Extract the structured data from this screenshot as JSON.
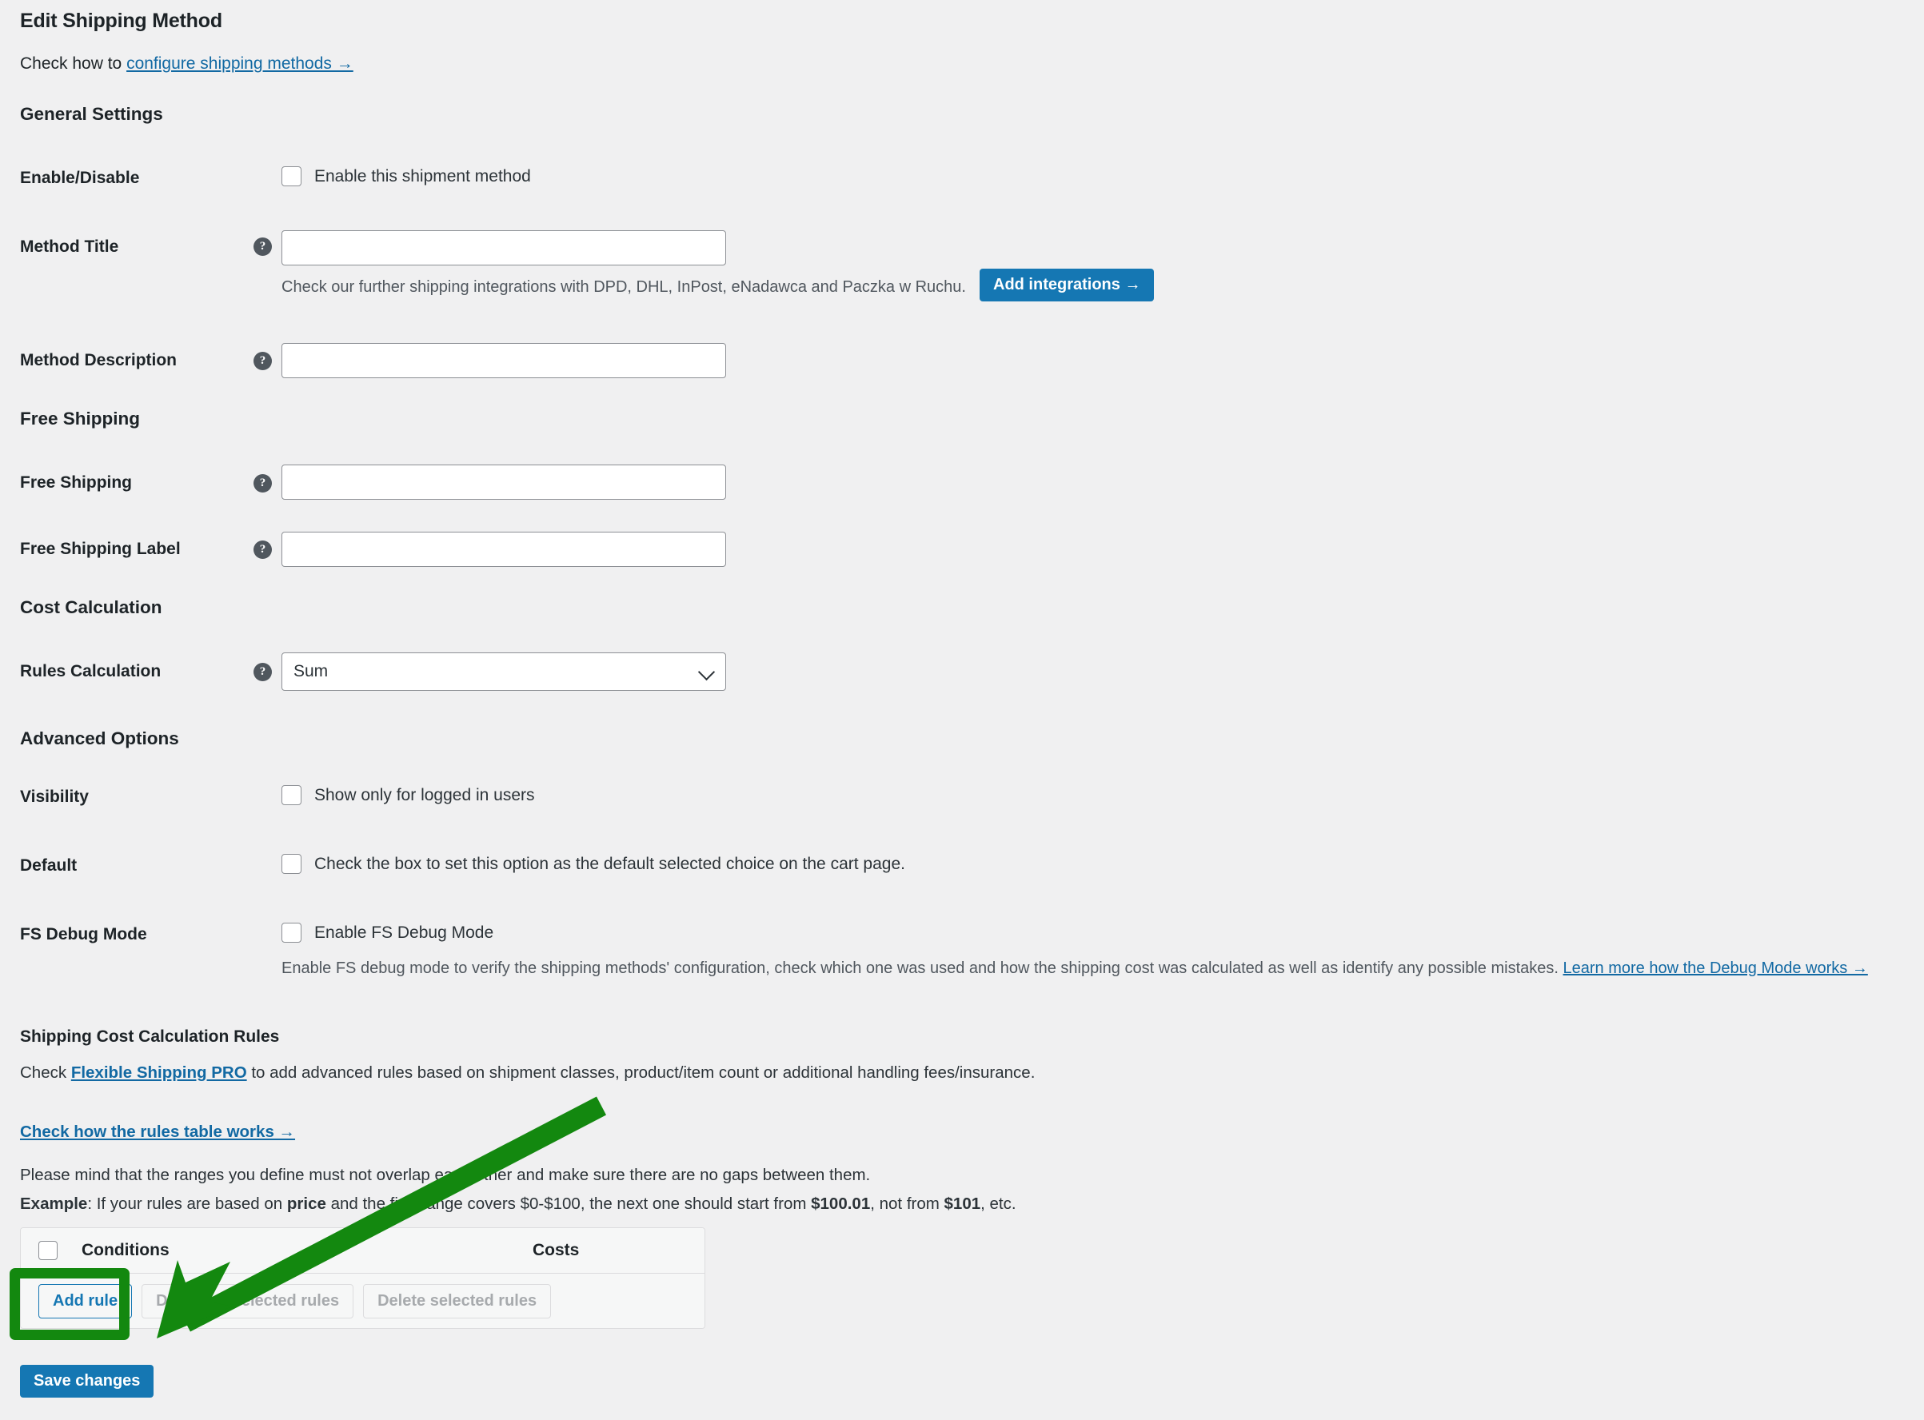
{
  "page": {
    "title": "Edit Shipping Method",
    "subline_prefix": "Check how to ",
    "subline_link": "configure shipping methods →"
  },
  "sections": {
    "general": "General Settings",
    "free_shipping": "Free Shipping",
    "cost_calculation": "Cost Calculation",
    "advanced": "Advanced Options"
  },
  "fields": {
    "enable_disable": {
      "label": "Enable/Disable",
      "checkbox_label": "Enable this shipment method",
      "checked": false
    },
    "method_title": {
      "label": "Method Title",
      "value": "",
      "help": "?",
      "hint": "Check our further shipping integrations with DPD, DHL, InPost, eNadawca and Paczka w Ruchu.",
      "hint_button": "Add integrations →"
    },
    "method_description": {
      "label": "Method Description",
      "value": "",
      "help": "?"
    },
    "free_shipping": {
      "label": "Free Shipping",
      "value": "",
      "help": "?"
    },
    "free_shipping_label": {
      "label": "Free Shipping Label",
      "value": "",
      "help": "?"
    },
    "rules_calculation": {
      "label": "Rules Calculation",
      "value": "Sum",
      "help": "?",
      "options": [
        "Sum"
      ]
    },
    "visibility": {
      "label": "Visibility",
      "checkbox_label": "Show only for logged in users",
      "checked": false
    },
    "default": {
      "label": "Default",
      "checkbox_label": "Check the box to set this option as the default selected choice on the cart page.",
      "checked": false
    },
    "fs_debug_mode": {
      "label": "FS Debug Mode",
      "checkbox_label": "Enable FS Debug Mode",
      "checked": false,
      "hint": "Enable FS debug mode to verify the shipping methods' configuration, check which one was used and how the shipping cost was calculated as well as identify any possible mistakes.",
      "hint_link": "Learn more how the Debug Mode works →"
    }
  },
  "rules": {
    "title": "Shipping Cost Calculation Rules",
    "pro_prefix": "Check ",
    "pro_link": "Flexible Shipping PRO",
    "pro_suffix": " to add advanced rules based on shipment classes, product/item count or additional handling fees/insurance.",
    "table_link": "Check how the rules table works →",
    "note": "Please mind that the ranges you define must not overlap each other and make sure there are no gaps between them.",
    "example_label": "Example",
    "example_text_a": ": If your rules are based on ",
    "example_bold_a": "price",
    "example_text_b": " and the first range covers $0-$100, the next one should start from ",
    "example_bold_b": "$100.01",
    "example_text_c": ", not from ",
    "example_bold_c": "$101",
    "example_text_d": ", etc.",
    "table": {
      "columns": [
        "Conditions",
        "Costs"
      ],
      "rows": [],
      "select_all_checked": false
    },
    "buttons": {
      "add_rule": "Add rule",
      "duplicate": "Duplicate selected rules",
      "delete": "Delete selected rules"
    }
  },
  "footer": {
    "save": "Save changes"
  },
  "annotation": {
    "highlight_color": "#13880f",
    "highlight_target": "Add rule",
    "arrow_color": "#13880f"
  },
  "colors": {
    "background": "#f0f0f1",
    "accent_blue": "#1577b3",
    "link_blue": "#1269a3",
    "text": "#1d2327",
    "muted": "#50575e"
  }
}
